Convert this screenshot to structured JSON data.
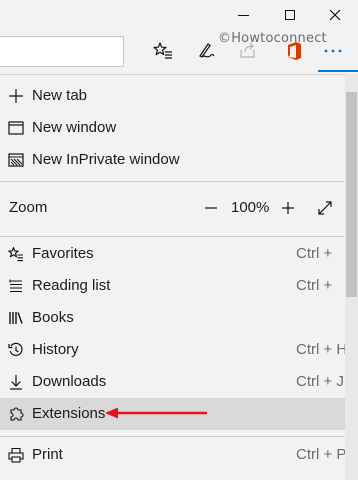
{
  "titlebar": {
    "controls": [
      "minimize-icon",
      "maximize-icon",
      "close-icon"
    ]
  },
  "toolbar": {
    "address_value": "",
    "icons": [
      "star-list-icon",
      "pen-icon",
      "share-icon",
      "office-icon",
      "more-icon"
    ],
    "watermark": "©Howtoconnect"
  },
  "menu": {
    "items": [
      {
        "label": "New tab",
        "shortcut": "",
        "icon": "plus-icon"
      },
      {
        "label": "New window",
        "shortcut": "",
        "icon": "window-icon"
      },
      {
        "label": "New InPrivate window",
        "shortcut": "",
        "icon": "inprivate-icon"
      },
      {
        "label": "Favorites",
        "shortcut": "Ctrl +",
        "icon": "favorites-star-icon"
      },
      {
        "label": "Reading list",
        "shortcut": "Ctrl +",
        "icon": "reading-list-icon"
      },
      {
        "label": "Books",
        "shortcut": "",
        "icon": "books-icon"
      },
      {
        "label": "History",
        "shortcut": "Ctrl + H",
        "icon": "history-icon"
      },
      {
        "label": "Downloads",
        "shortcut": "Ctrl + J",
        "icon": "download-icon"
      },
      {
        "label": "Extensions",
        "shortcut": "",
        "icon": "extensions-puzzle-icon"
      },
      {
        "label": "Print",
        "shortcut": "Ctrl + P",
        "icon": "print-icon"
      }
    ],
    "zoom": {
      "label": "Zoom",
      "value": "100%"
    },
    "highlighted_item": "Extensions"
  },
  "colors": {
    "accent": "#0078d7",
    "highlight_row": "#d9d9d9",
    "annotation_arrow": "#e0141e",
    "office_icon": "#d83b01"
  }
}
